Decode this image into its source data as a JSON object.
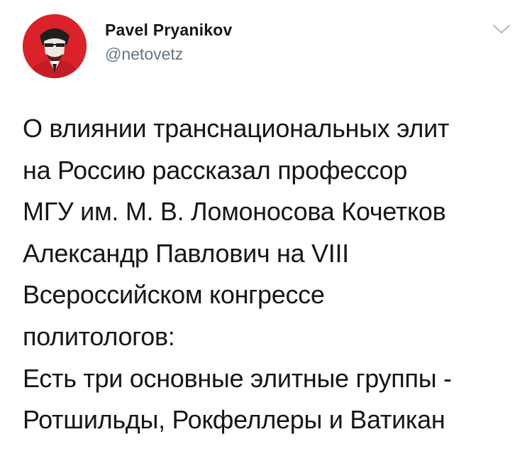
{
  "tweet": {
    "author": {
      "display_name": "Pavel Pryanikov",
      "handle": "@netovetz"
    },
    "icons": {
      "avatar": "profile-avatar",
      "menu": "chevron-down-icon"
    },
    "colors": {
      "avatar_background": "#d9222a",
      "handle": "#657786",
      "text": "#14171a"
    },
    "text": "О влиянии транснациональных элит\nна Россию рассказал профессор\nМГУ им. М. В. Ломоносова Кочетков\nАлександр Павлович на VIII\nВсероссийском конгрессе\nполитологов:\nЕсть три основные элитные группы -\nРотшильды, Рокфеллеры и Ватикан"
  }
}
